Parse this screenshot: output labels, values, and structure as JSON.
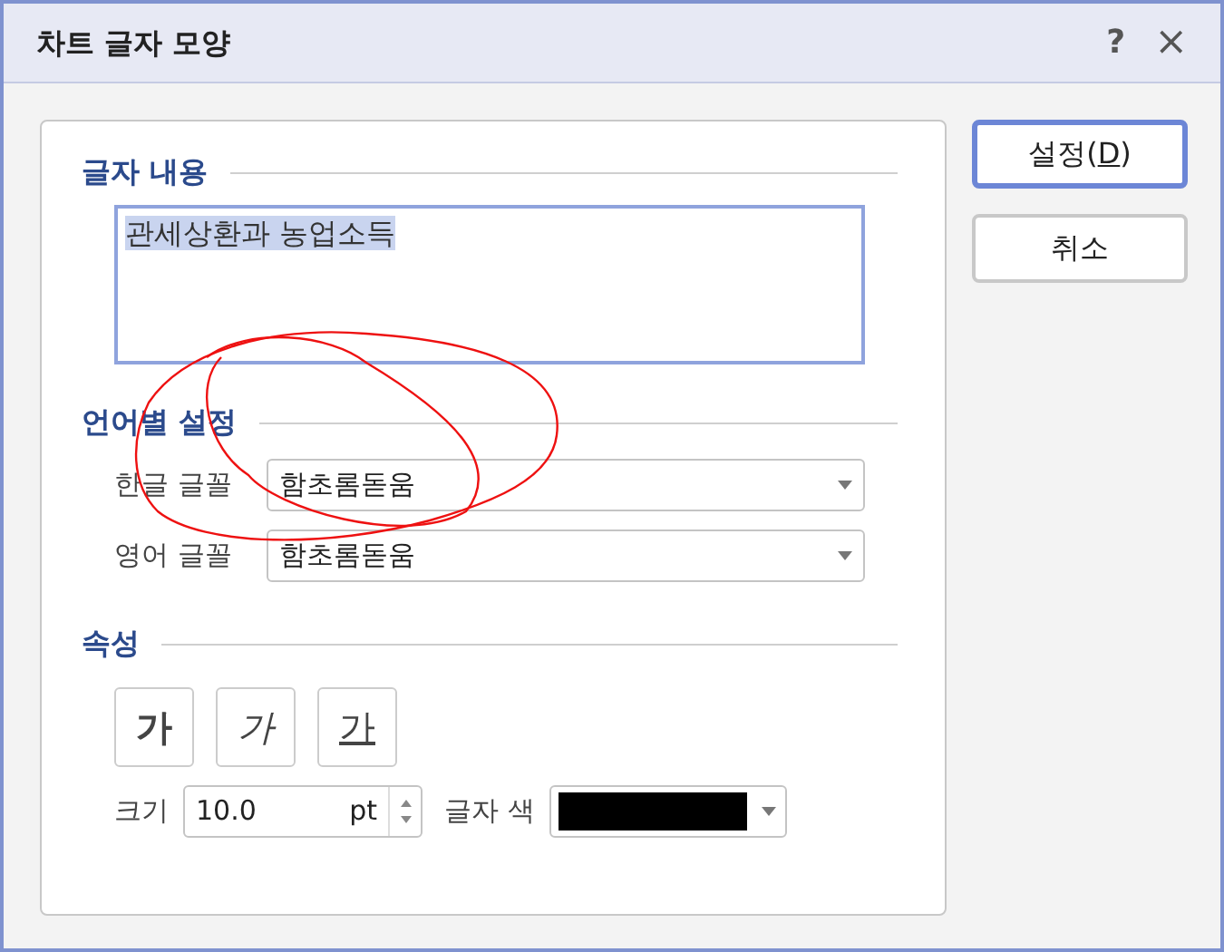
{
  "window": {
    "title": "차트 글자 모양",
    "help": "?",
    "close": "×"
  },
  "content_section": {
    "title": "글자 내용",
    "text": "관세상환과 농업소득"
  },
  "language_section": {
    "title": "언어별 설정",
    "fonts": [
      {
        "label": "한글 글꼴",
        "value": "함초롬돋움"
      },
      {
        "label": "영어 글꼴",
        "value": "함초롬돋움"
      }
    ]
  },
  "attributes_section": {
    "title": "속성",
    "style_buttons": [
      {
        "label": "가",
        "kind": "bold"
      },
      {
        "label": "가",
        "kind": "italic"
      },
      {
        "label": "가",
        "kind": "underline"
      }
    ],
    "size": {
      "label": "크기",
      "value": "10.0",
      "unit": "pt"
    },
    "font_color": {
      "label": "글자 색",
      "color": "#000000"
    }
  },
  "buttons": [
    {
      "label": "설정(",
      "mnemonic": "D",
      "label_end": ")",
      "default": true
    },
    {
      "label": "취소",
      "default": false
    }
  ]
}
